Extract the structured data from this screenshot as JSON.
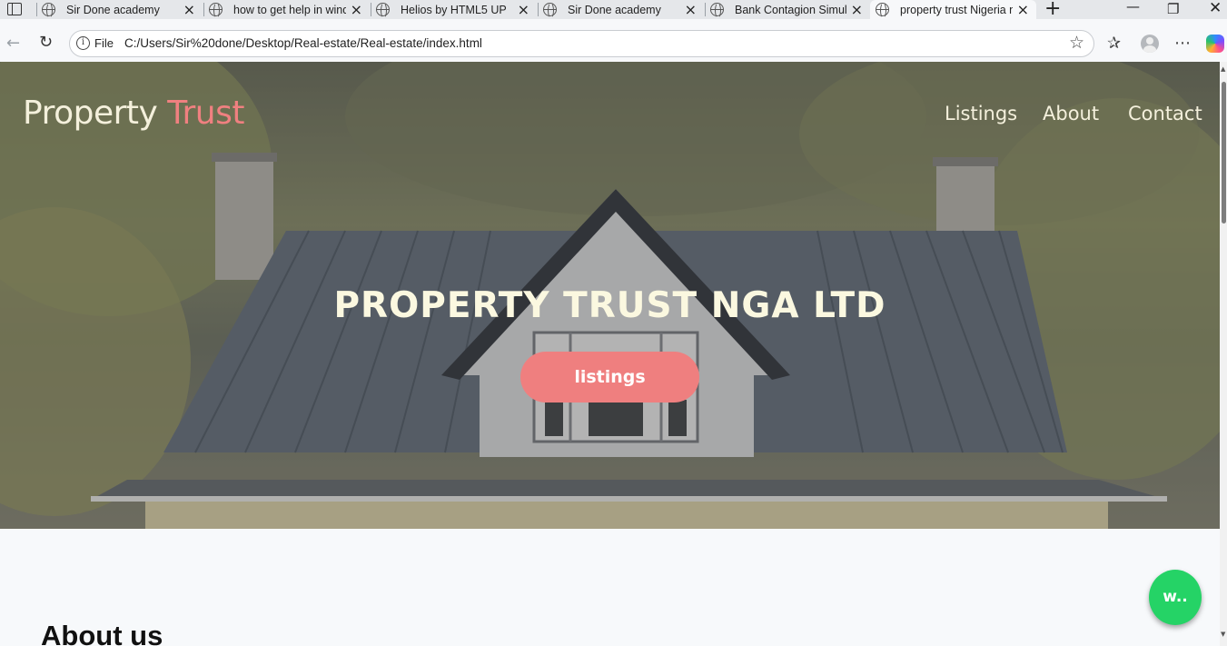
{
  "browser": {
    "tabs": [
      {
        "title": "Sir Done academy"
      },
      {
        "title": "how to get help in windows"
      },
      {
        "title": "Helios by HTML5 UP"
      },
      {
        "title": "Sir Done academy"
      },
      {
        "title": "Bank Contagion Simulator"
      },
      {
        "title": "property trust Nigeria nga"
      }
    ],
    "address": {
      "scheme": "File",
      "url": "C:/Users/Sir%20done/Desktop/Real-estate/Real-estate/index.html"
    }
  },
  "page": {
    "brand": {
      "part1": "Property",
      "part2": "Trust"
    },
    "nav": [
      "Listings",
      "About",
      "Contact"
    ],
    "hero": {
      "title": "PROPERTY TRUST NGA LTD",
      "button": "listings"
    },
    "about_title": "About us",
    "whatsapp_label": "w.."
  },
  "colors": {
    "accent": "#ef7f7f",
    "whatsapp": "#25d366",
    "hero_text": "#fbf8e0"
  }
}
